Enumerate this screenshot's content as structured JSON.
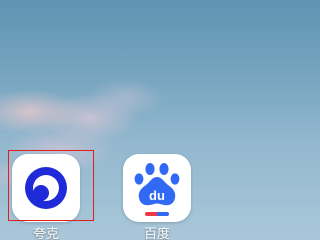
{
  "wallpaper": {
    "sky_color": "#7aa7c1",
    "cloud_color": "#e4c8cd"
  },
  "apps": [
    {
      "label": "夸克",
      "icon": "quark-icon",
      "accent": "#1f2bd8"
    },
    {
      "label": "百度",
      "icon": "baidu-paw-icon",
      "accent": "#3169f5",
      "logo_text": "du"
    }
  ],
  "highlight": {
    "color": "#e02020",
    "target": "夸克"
  }
}
